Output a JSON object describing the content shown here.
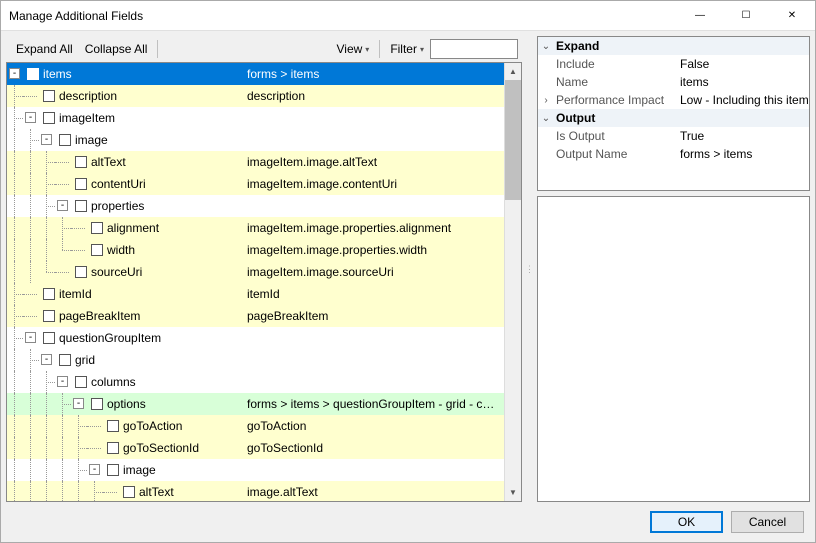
{
  "title": "Manage Additional Fields",
  "winbuttons": {
    "min": "—",
    "max": "☐",
    "close": "✕"
  },
  "toolbar": {
    "expand_all": "Expand All",
    "collapse_all": "Collapse All",
    "view": "View",
    "filter": "Filter",
    "filter_value": ""
  },
  "tree": [
    {
      "depth": 0,
      "exp": "-",
      "label": "items",
      "col2": "forms > items",
      "style": "selected",
      "chkWhite": true
    },
    {
      "depth": 1,
      "exp": "",
      "label": "description",
      "col2": "description",
      "style": "yellow"
    },
    {
      "depth": 1,
      "exp": "-",
      "label": "imageItem",
      "col2": ""
    },
    {
      "depth": 2,
      "exp": "-",
      "label": "image",
      "col2": ""
    },
    {
      "depth": 3,
      "exp": "",
      "label": "altText",
      "col2": "imageItem.image.altText",
      "style": "yellow"
    },
    {
      "depth": 3,
      "exp": "",
      "label": "contentUri",
      "col2": "imageItem.image.contentUri",
      "style": "yellow"
    },
    {
      "depth": 3,
      "exp": "-",
      "label": "properties",
      "col2": ""
    },
    {
      "depth": 4,
      "exp": "",
      "label": "alignment",
      "col2": "imageItem.image.properties.alignment",
      "style": "yellow"
    },
    {
      "depth": 4,
      "exp": "",
      "label": "width",
      "col2": "imageItem.image.properties.width",
      "style": "yellow",
      "last": true
    },
    {
      "depth": 3,
      "exp": "",
      "label": "sourceUri",
      "col2": "imageItem.image.sourceUri",
      "style": "yellow",
      "last": true
    },
    {
      "depth": 1,
      "exp": "",
      "label": "itemId",
      "col2": "itemId",
      "style": "yellow"
    },
    {
      "depth": 1,
      "exp": "",
      "label": "pageBreakItem",
      "col2": "pageBreakItem",
      "style": "yellow"
    },
    {
      "depth": 1,
      "exp": "-",
      "label": "questionGroupItem",
      "col2": ""
    },
    {
      "depth": 2,
      "exp": "-",
      "label": "grid",
      "col2": ""
    },
    {
      "depth": 3,
      "exp": "-",
      "label": "columns",
      "col2": ""
    },
    {
      "depth": 4,
      "exp": "-",
      "label": "options",
      "col2": "forms > items > questionGroupItem - grid - column...",
      "style": "green"
    },
    {
      "depth": 5,
      "exp": "",
      "label": "goToAction",
      "col2": "goToAction",
      "style": "yellow"
    },
    {
      "depth": 5,
      "exp": "",
      "label": "goToSectionId",
      "col2": "goToSectionId",
      "style": "yellow"
    },
    {
      "depth": 5,
      "exp": "-",
      "label": "image",
      "col2": ""
    },
    {
      "depth": 6,
      "exp": "",
      "label": "altText",
      "col2": "image.altText",
      "style": "yellow"
    }
  ],
  "props": {
    "cat1": "Expand",
    "include_k": "Include",
    "include_v": "False",
    "name_k": "Name",
    "name_v": "items",
    "perf_k": "Performance Impact",
    "perf_v": "Low - Including this item will hav",
    "cat2": "Output",
    "isout_k": "Is Output",
    "isout_v": "True",
    "outname_k": "Output Name",
    "outname_v": "forms > items"
  },
  "buttons": {
    "ok": "OK",
    "cancel": "Cancel"
  }
}
